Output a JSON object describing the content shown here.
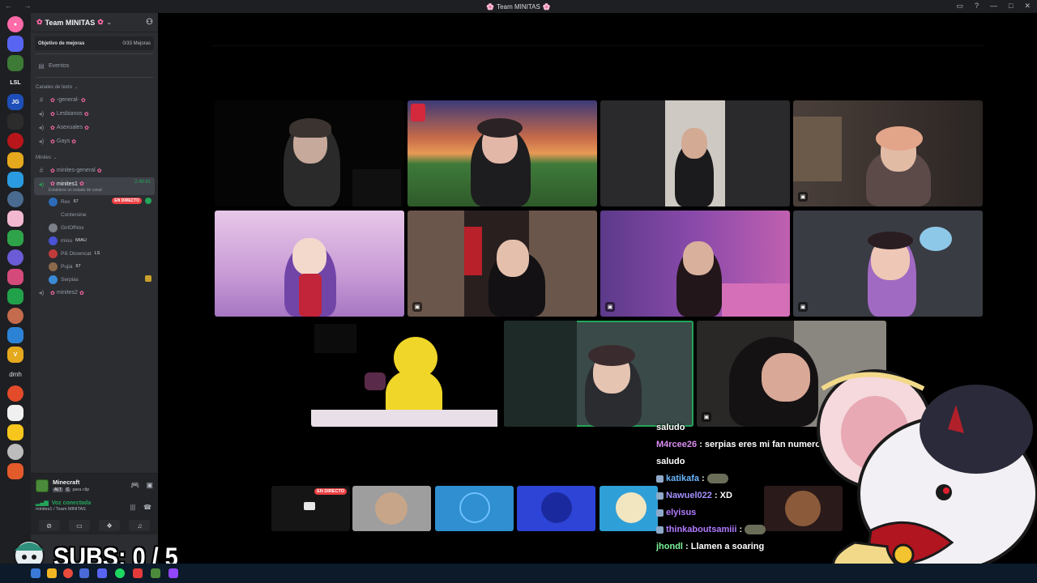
{
  "window": {
    "title": "Team MINITAS",
    "title_flower": "🌸"
  },
  "rail": {
    "servers": [
      {
        "name": "server-1",
        "color": "#ff6aa8",
        "label": "●"
      },
      {
        "name": "server-2",
        "color": "#5865f2",
        "label": ""
      },
      {
        "name": "server-3",
        "color": "#3c7a36",
        "label": ""
      },
      {
        "name": "server-4",
        "color": "#1e1f22",
        "label": "LSL"
      },
      {
        "name": "server-5",
        "color": "#1e4fb8",
        "label": "JG"
      },
      {
        "name": "server-6",
        "color": "#2c2c2c",
        "label": ""
      },
      {
        "name": "server-7",
        "color": "#b8161b",
        "label": ""
      },
      {
        "name": "server-8",
        "color": "#e5a91d",
        "label": ""
      },
      {
        "name": "server-9",
        "color": "#2a9be0",
        "label": ""
      },
      {
        "name": "server-10",
        "color": "#4a6b90",
        "label": ""
      },
      {
        "name": "server-11",
        "color": "#f2b8d0",
        "label": ""
      },
      {
        "name": "server-12",
        "color": "#2fa34a",
        "label": ""
      },
      {
        "name": "server-13",
        "color": "#6b5bd6",
        "label": ""
      },
      {
        "name": "server-14",
        "color": "#d44a7a",
        "label": ""
      },
      {
        "name": "server-15",
        "color": "#22a14b",
        "label": ""
      },
      {
        "name": "server-16",
        "color": "#c46b4d",
        "label": ""
      },
      {
        "name": "server-17",
        "color": "#2c83d6",
        "label": ""
      },
      {
        "name": "server-18",
        "color": "#e5a91d",
        "label": "V"
      },
      {
        "name": "server-19",
        "color": "#e34b2b",
        "label": ""
      },
      {
        "name": "server-20",
        "color": "#f0f0f0",
        "label": ""
      },
      {
        "name": "server-21",
        "color": "#f6c61c",
        "label": ""
      },
      {
        "name": "server-22",
        "color": "#bcbcbc",
        "label": ""
      },
      {
        "name": "server-23",
        "color": "#e35a2b",
        "label": ""
      }
    ],
    "text_server": "dmh"
  },
  "sidebar": {
    "server_name": "Team MINITAS",
    "boost_label": "Objetivo de mejoras",
    "boost_count": "0/33 Mejoras",
    "events_label": "Eventos",
    "text_category": "Canales de texto",
    "text_channels": [
      {
        "name": "-general-",
        "type": "text"
      },
      {
        "name": "Lesbianos",
        "type": "voice"
      },
      {
        "name": "Asexuales",
        "type": "voice"
      },
      {
        "name": "Gays",
        "type": "voice"
      }
    ],
    "minites_category": "Minites",
    "minites_general": "minites-general",
    "active_channel": {
      "name": "minites1",
      "timer": "2:49:41",
      "status": "Establece un estado de canal"
    },
    "voice_users": [
      {
        "name": "Rex",
        "extra": "67",
        "color": "#2d6bb8",
        "live": "EN DIRECTO"
      },
      {
        "name": "Contersine",
        "extra": "",
        "color": "#2b2d31",
        "live": ""
      },
      {
        "name": "GirlOfNox",
        "extra": "",
        "color": "#7b7f88",
        "live": ""
      },
      {
        "name": "miou",
        "extra": "MIAU",
        "color": "#4a52d6",
        "live": ""
      },
      {
        "name": "Pili Dtowncat",
        "extra": "LS",
        "color": "#c23b3b",
        "live": ""
      },
      {
        "name": "Pujia",
        "extra": "67",
        "color": "#8a6a4a",
        "live": ""
      },
      {
        "name": "Serpias",
        "extra": "",
        "color": "#3b8ad6",
        "live": ""
      }
    ],
    "minites2": "minites2"
  },
  "activity": {
    "game": "Minecraft",
    "key": "ALT",
    "key2": "C",
    "hint": "para clip"
  },
  "voice_panel": {
    "status": "Voz conectada",
    "location": "minites1 / Team MINITAS"
  },
  "stage": {
    "live_label": "EN DIRECTO"
  },
  "chat": {
    "messages": [
      {
        "user": "",
        "text": "saludo"
      },
      {
        "user": "M4rcee26",
        "text": " : serpias eres mi fan numero 1"
      },
      {
        "user": "",
        "text": "saludo"
      },
      {
        "user": "katikafa",
        "text": " :"
      },
      {
        "user": "Nawuel022",
        "text": " : XD"
      },
      {
        "user": "elyisus",
        "text": ""
      },
      {
        "user": "thinkaboutsamiii",
        "text": " :"
      },
      {
        "user": "jhondl",
        "text": " : Llamen a soaring"
      }
    ]
  },
  "overlay": {
    "subs_text": "SUBS: 0 / 5"
  },
  "colors": {
    "accent": "#5865f2",
    "live": "#ed4245",
    "connected": "#23a55a",
    "flower": "#ff6aa8"
  }
}
